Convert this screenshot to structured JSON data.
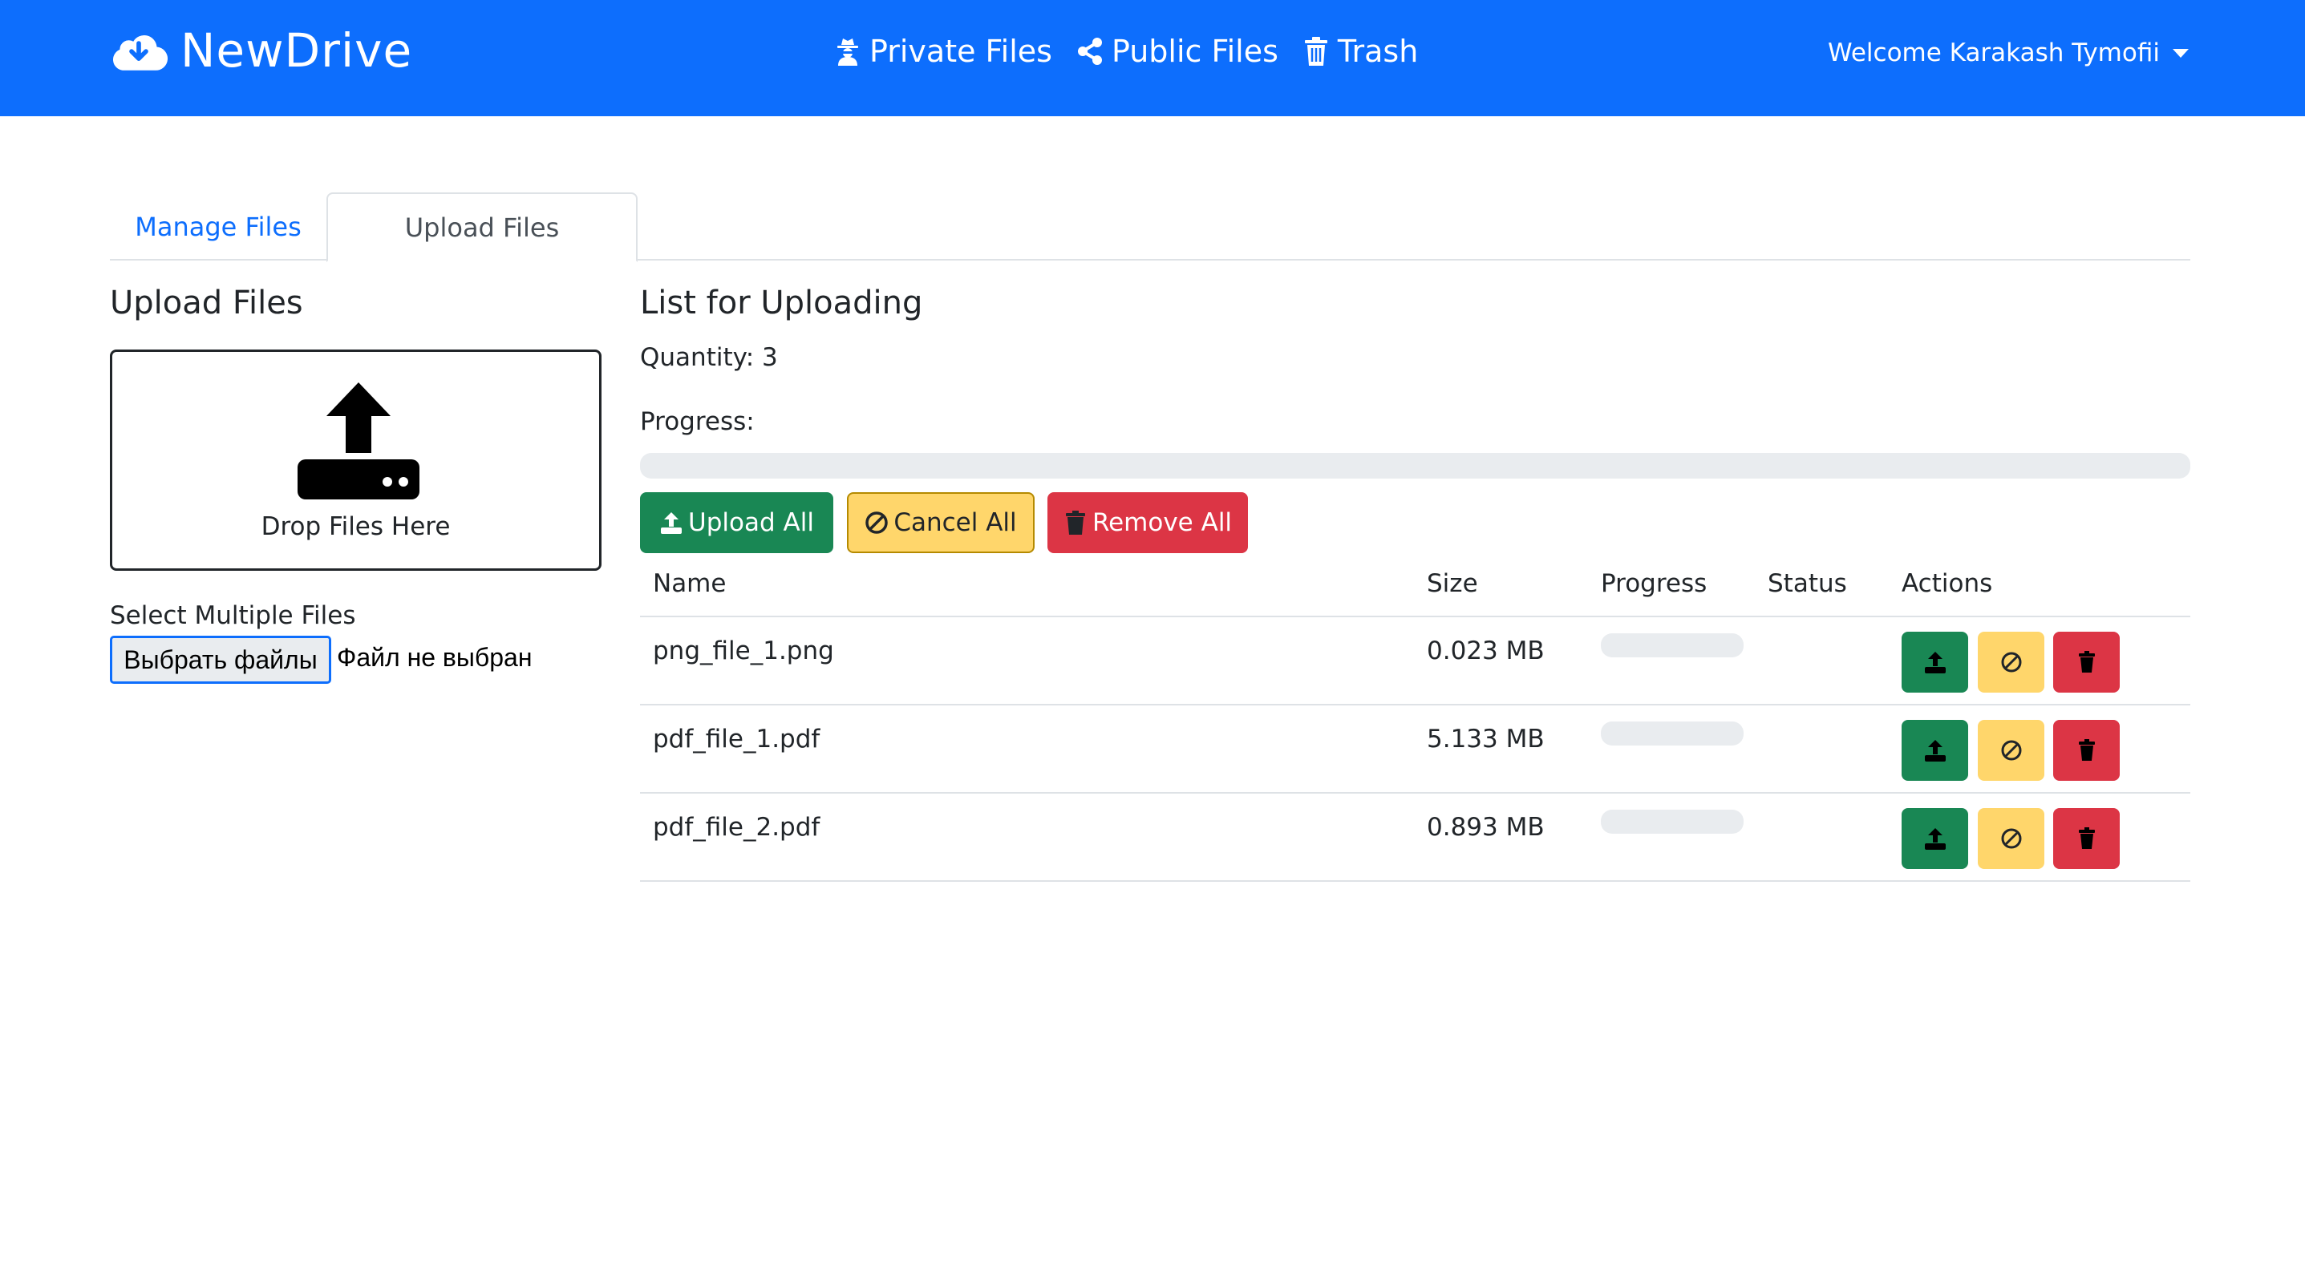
{
  "navbar": {
    "brand": "NewDrive",
    "links": [
      {
        "label": "Private Files",
        "icon": "user-secret-icon"
      },
      {
        "label": "Public Files",
        "icon": "share-icon"
      },
      {
        "label": "Trash",
        "icon": "trash-icon"
      }
    ],
    "welcome": "Welcome Karakash Tymofii"
  },
  "tabs": [
    {
      "label": "Manage Files",
      "active": false
    },
    {
      "label": "Upload Files",
      "active": true
    }
  ],
  "upload_panel": {
    "title": "Upload Files",
    "dropzone_text": "Drop Files Here",
    "select_label": "Select Multiple Files",
    "file_button": "Выбрать файлы",
    "file_status": "Файл не выбран"
  },
  "list_panel": {
    "title": "List for Uploading",
    "quantity": "Quantity: 3",
    "progress_label": "Progress:",
    "progress_value": 0,
    "buttons": {
      "upload_all": "Upload All",
      "cancel_all": "Cancel All",
      "remove_all": "Remove All"
    },
    "columns": [
      "Name",
      "Size",
      "Progress",
      "Status",
      "Actions"
    ],
    "files": [
      {
        "name": "png_file_1.png",
        "size": "0.023 MB",
        "progress": 0,
        "status": ""
      },
      {
        "name": "pdf_file_1.pdf",
        "size": "5.133 MB",
        "progress": 0,
        "status": ""
      },
      {
        "name": "pdf_file_2.pdf",
        "size": "0.893 MB",
        "progress": 0,
        "status": ""
      }
    ]
  },
  "colors": {
    "primary": "#0d6efd",
    "success": "#198754",
    "warning": "#ffc107",
    "danger": "#dc3545"
  }
}
